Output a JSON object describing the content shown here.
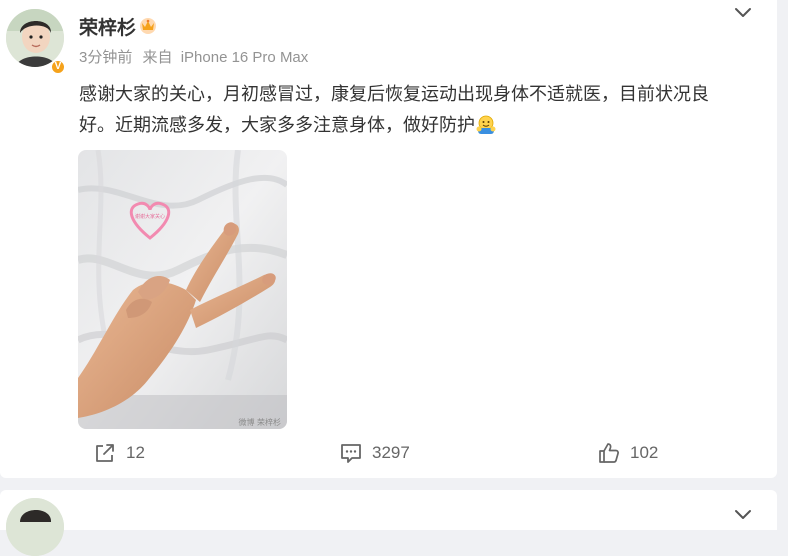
{
  "post": {
    "author": "荣梓杉",
    "time": "3分钟前",
    "source_prefix": "来自",
    "source": "iPhone 16 Pro Max",
    "text": "感谢大家的关心，月初感冒过，康复后恢复运动出现身体不适就医，目前状况良好。近期流感多发，大家多多注意身体，做好防护",
    "emoji": "hug-emoji",
    "photo": {
      "sticker_text": "谢谢大家关心",
      "watermark": "微博 荣梓杉"
    },
    "verified_badge": "V",
    "actions": {
      "repost_count": "12",
      "comment_count": "3297",
      "like_count": "102"
    }
  },
  "colors": {
    "accent_badge": "#f5a21b",
    "text": "#333333",
    "meta": "#939393"
  }
}
